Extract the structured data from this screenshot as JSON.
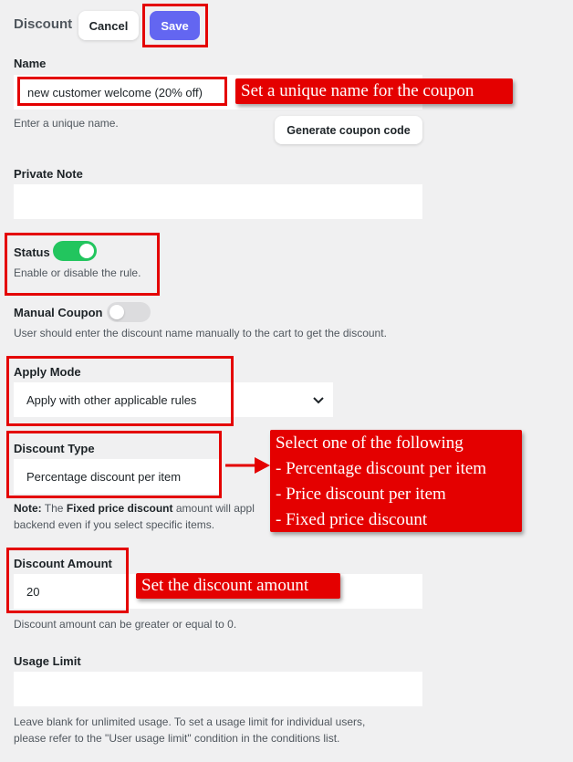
{
  "header": {
    "title": "Discount",
    "cancel_label": "Cancel",
    "save_label": "Save"
  },
  "name": {
    "label": "Name",
    "value": "new customer welcome (20% off)",
    "hint": "Enter a unique name.",
    "generate_label": "Generate coupon code"
  },
  "private_note": {
    "label": "Private Note",
    "value": ""
  },
  "status": {
    "label": "Status",
    "hint": "Enable or disable the rule.",
    "enabled": true
  },
  "manual_coupon": {
    "label": "Manual Coupon",
    "hint": "User should enter the discount name manually to the cart to get the discount.",
    "enabled": false
  },
  "apply_mode": {
    "label": "Apply Mode",
    "value": "Apply with other applicable rules"
  },
  "discount_type": {
    "label": "Discount Type",
    "value": "Percentage discount per item",
    "note_prefix": "Note:",
    "note_t1": " The ",
    "note_bold": "Fixed price discount",
    "note_t2": " amount will appl",
    "note_line2": "backend even if you select specific items."
  },
  "discount_amount": {
    "label": "Discount Amount",
    "value": "20",
    "hint": "Discount amount can be greater or equal to 0."
  },
  "usage_limit": {
    "label": "Usage Limit",
    "value": "",
    "hint_line1": "Leave blank for unlimited usage. To set a usage limit for individual users,",
    "hint_line2": "please refer to the \"User usage limit\" condition in the conditions list."
  },
  "annotations": {
    "name_callout": "Set a unique name for the coupon",
    "amount_callout": "Set the discount amount",
    "type_callout": [
      "Select one of the following",
      "- Percentage discount per item",
      "- Price discount per item",
      "- Fixed price discount"
    ]
  },
  "colors": {
    "accent": "#6366f1",
    "toggle_on": "#22c55e",
    "annotation_red": "#e40000",
    "background": "#f0f0f1"
  }
}
